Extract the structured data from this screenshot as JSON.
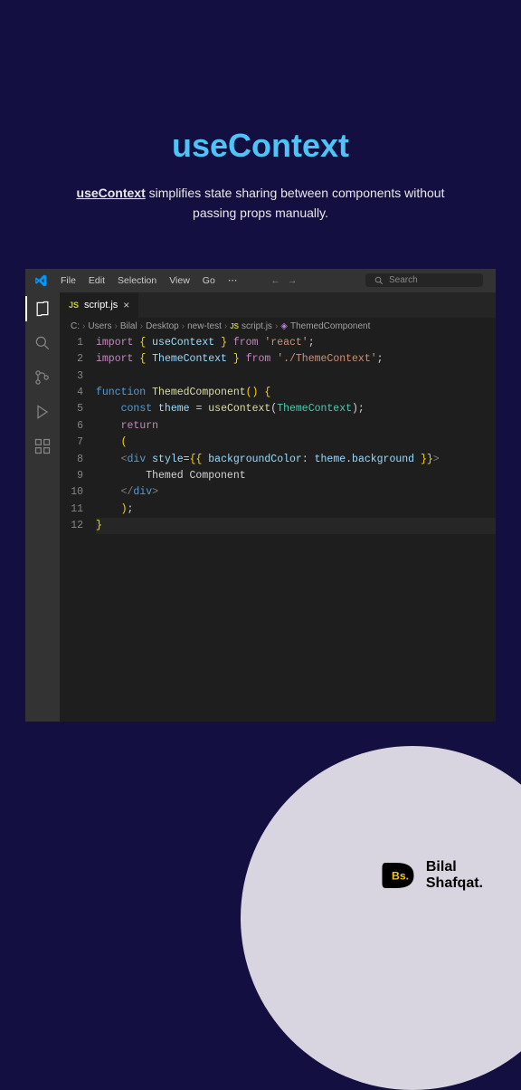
{
  "page": {
    "title": "useContext",
    "subtitle_strong": "useContext",
    "subtitle_rest": " simplifies state sharing between components without passing props manually."
  },
  "titlebar": {
    "menu": [
      "File",
      "Edit",
      "Selection",
      "View",
      "Go"
    ],
    "search_placeholder": "Search"
  },
  "tab": {
    "filename": "script.js"
  },
  "breadcrumbs": {
    "parts": [
      "C:",
      "Users",
      "Bilal",
      "Desktop",
      "new-test"
    ],
    "file": "script.js",
    "symbol": "ThemedComponent"
  },
  "code": {
    "line_count": 12
  },
  "brand": {
    "name1": "Bilal",
    "name2": "Shafqat.",
    "badge": "Bs."
  }
}
